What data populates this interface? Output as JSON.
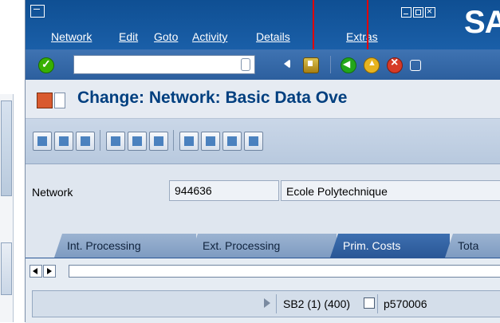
{
  "menu": {
    "items": [
      "Network",
      "Edit",
      "Goto",
      "Activity",
      "Details",
      "Extras"
    ],
    "logo_text": "SA"
  },
  "toolbar": {
    "command_field_value": ""
  },
  "title": {
    "text": "Change: Network: Basic Data Ove"
  },
  "network": {
    "label": "Network",
    "id_value": "944636",
    "description": "Ecole Polytechnique"
  },
  "tabs": [
    {
      "label": "Int. Processing",
      "active": false
    },
    {
      "label": "Ext. Processing",
      "active": false
    },
    {
      "label": "Prim. Costs",
      "active": true
    },
    {
      "label": "Tota",
      "active": false
    }
  ],
  "status": {
    "session": "SB2 (1) (400)",
    "server": "p570006"
  },
  "annotations": {
    "arrow_color": "#e10000"
  }
}
